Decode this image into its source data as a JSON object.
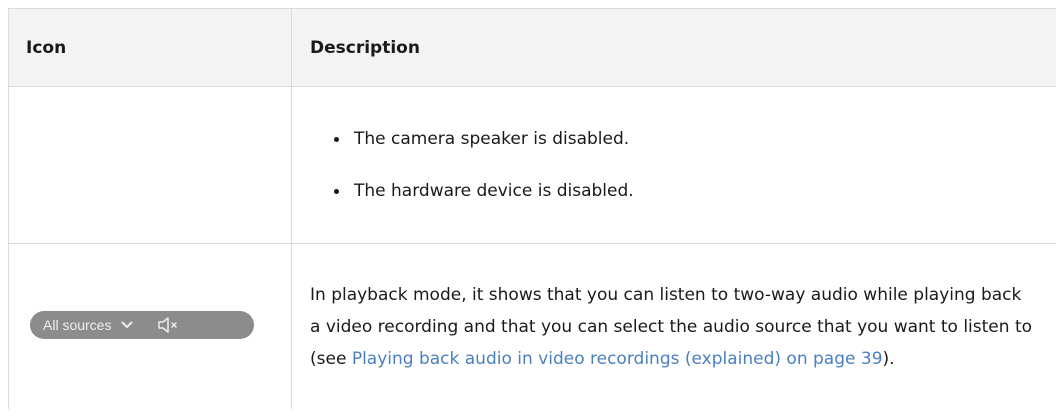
{
  "table": {
    "headers": {
      "icon": "Icon",
      "description": "Description"
    },
    "rows": [
      {
        "icon": "",
        "bullets": [
          "The camera speaker is disabled.",
          "The hardware device is disabled."
        ]
      },
      {
        "icon": {
          "label": "All sources",
          "dropdown_icon": "chevron-down-icon",
          "speaker_icon": "speaker-muted-icon",
          "background": "#8c8c8c"
        },
        "description": {
          "text_before": "In playback mode, it shows that you can listen to two-way audio while playing back a video recording and that you can select the audio source that you want to listen to (see ",
          "link_text": "Playing back audio in video recordings (explained) on page 39",
          "text_after": ")."
        }
      }
    ]
  },
  "colors": {
    "link": "#4a7fc1",
    "header_background": "#f3f3f3",
    "border": "#dcdcdc"
  }
}
